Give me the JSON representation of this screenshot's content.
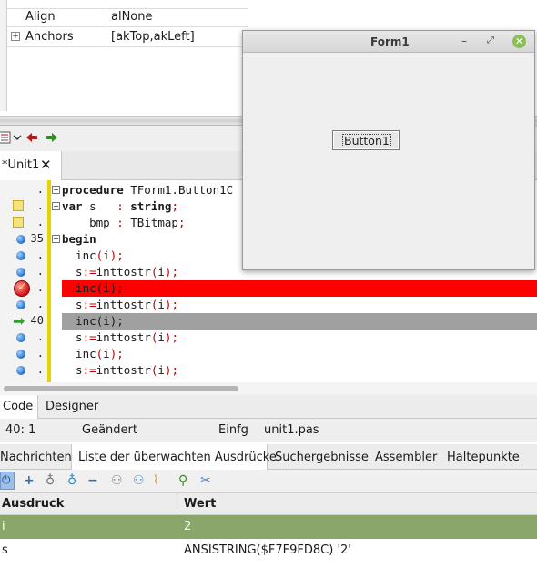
{
  "object_inspector": {
    "rows": [
      {
        "name": "Align",
        "value": "alNone",
        "expander": ""
      },
      {
        "name": "Anchors",
        "value": "[akTop,akLeft]",
        "expander": "+"
      }
    ]
  },
  "toolbar": {
    "icons": [
      "list-icon",
      "chevron-down-icon",
      "back-arrow-icon",
      "forward-arrow-icon"
    ]
  },
  "editor": {
    "tab_label": "*Unit1",
    "tab_close": "✕",
    "lines": [
      {
        "num": ".",
        "marker": "",
        "fold": "−",
        "tokens": [
          [
            "kw",
            "procedure"
          ],
          [
            "",
            " TForm1.Button1C"
          ]
        ]
      },
      {
        "num": ".",
        "marker": "note",
        "fold": "−",
        "tokens": [
          [
            "kw",
            "var"
          ],
          [
            "",
            " s   "
          ],
          [
            "sym",
            ":"
          ],
          [
            "",
            " "
          ],
          [
            "kw",
            "string"
          ],
          [
            "sym",
            ";"
          ]
        ]
      },
      {
        "num": ".",
        "marker": "note",
        "fold": "",
        "tokens": [
          [
            "",
            "    bmp "
          ],
          [
            "sym",
            ":"
          ],
          [
            "",
            " TBitmap"
          ],
          [
            "sym",
            ";"
          ]
        ]
      },
      {
        "num": "35",
        "marker": "dot",
        "fold": "−",
        "tokens": [
          [
            "kw",
            "begin"
          ]
        ]
      },
      {
        "num": ".",
        "marker": "dot",
        "fold": "",
        "tokens": [
          [
            "",
            "  inc"
          ],
          [
            "sym",
            "("
          ],
          [
            "",
            "i"
          ],
          [
            "sym",
            ")"
          ],
          [
            "sym",
            ";"
          ]
        ]
      },
      {
        "num": ".",
        "marker": "dot",
        "fold": "",
        "tokens": [
          [
            "",
            "  s"
          ],
          [
            "sym",
            ":="
          ],
          [
            "",
            "inttostr"
          ],
          [
            "sym",
            "("
          ],
          [
            "",
            "i"
          ],
          [
            "sym",
            ")"
          ],
          [
            "sym",
            ";"
          ]
        ]
      },
      {
        "num": ".",
        "marker": "breakpoint",
        "fold": "",
        "tokens": [
          [
            "",
            "  inc"
          ],
          [
            "",
            "("
          ],
          [
            "",
            "i"
          ],
          [
            "",
            ")"
          ],
          [
            "",
            ";"
          ]
        ]
      },
      {
        "num": ".",
        "marker": "dot",
        "fold": "",
        "tokens": [
          [
            "",
            "  s"
          ],
          [
            "sym",
            ":="
          ],
          [
            "",
            "inttostr"
          ],
          [
            "sym",
            "("
          ],
          [
            "",
            "i"
          ],
          [
            "sym",
            ")"
          ],
          [
            "sym",
            ";"
          ]
        ]
      },
      {
        "num": "40",
        "marker": "arrow",
        "fold": "",
        "tokens": [
          [
            "",
            "  inc"
          ],
          [
            "",
            "("
          ],
          [
            "",
            "i"
          ],
          [
            "",
            ")"
          ],
          [
            "",
            ";"
          ]
        ]
      },
      {
        "num": ".",
        "marker": "dot",
        "fold": "",
        "tokens": [
          [
            "",
            "  s"
          ],
          [
            "sym",
            ":="
          ],
          [
            "",
            "inttostr"
          ],
          [
            "sym",
            "("
          ],
          [
            "",
            "i"
          ],
          [
            "sym",
            ")"
          ],
          [
            "sym",
            ";"
          ]
        ]
      },
      {
        "num": ".",
        "marker": "dot",
        "fold": "",
        "tokens": [
          [
            "",
            "  inc"
          ],
          [
            "sym",
            "("
          ],
          [
            "",
            "i"
          ],
          [
            "sym",
            ")"
          ],
          [
            "sym",
            ";"
          ]
        ]
      },
      {
        "num": ".",
        "marker": "dot",
        "fold": "",
        "tokens": [
          [
            "",
            "  s"
          ],
          [
            "sym",
            ":="
          ],
          [
            "",
            "inttostr"
          ],
          [
            "sym",
            "("
          ],
          [
            "",
            "i"
          ],
          [
            "sym",
            ")"
          ],
          [
            "sym",
            ";"
          ]
        ]
      }
    ],
    "colors": {
      "breakpoint_line": "#ff0000",
      "exec_line": "#a0a0a0",
      "gutter_bar": "#e6d300"
    }
  },
  "form1": {
    "title": "Form1",
    "min": "–",
    "max": "⤢",
    "close": "✕",
    "button_label": "Button1"
  },
  "editor_tabs": [
    "Code",
    "Designer"
  ],
  "status": {
    "position": "40:  1",
    "modified": "Geändert",
    "mode": "Einfg",
    "file": "unit1.pas"
  },
  "debug_tabs": [
    "Nachrichten",
    "Liste der überwachten Ausdrücke",
    "Suchergebnisse",
    "Assembler",
    "Haltepunkte"
  ],
  "watch_toolbar": {
    "icons": [
      "power-icon",
      "add-icon",
      "light-off-icon",
      "light-on-icon",
      "remove-icon",
      "disable-all-icon",
      "enable-all-icon",
      "clear-icon",
      "inspect-icon",
      "evaluate-icon"
    ]
  },
  "watches": {
    "headers": [
      "Ausdruck",
      "Wert"
    ],
    "rows": [
      {
        "expr": "i",
        "value": "2"
      },
      {
        "expr": "s",
        "value": "ANSISTRING($F7F9FD8C) '2'"
      }
    ]
  }
}
